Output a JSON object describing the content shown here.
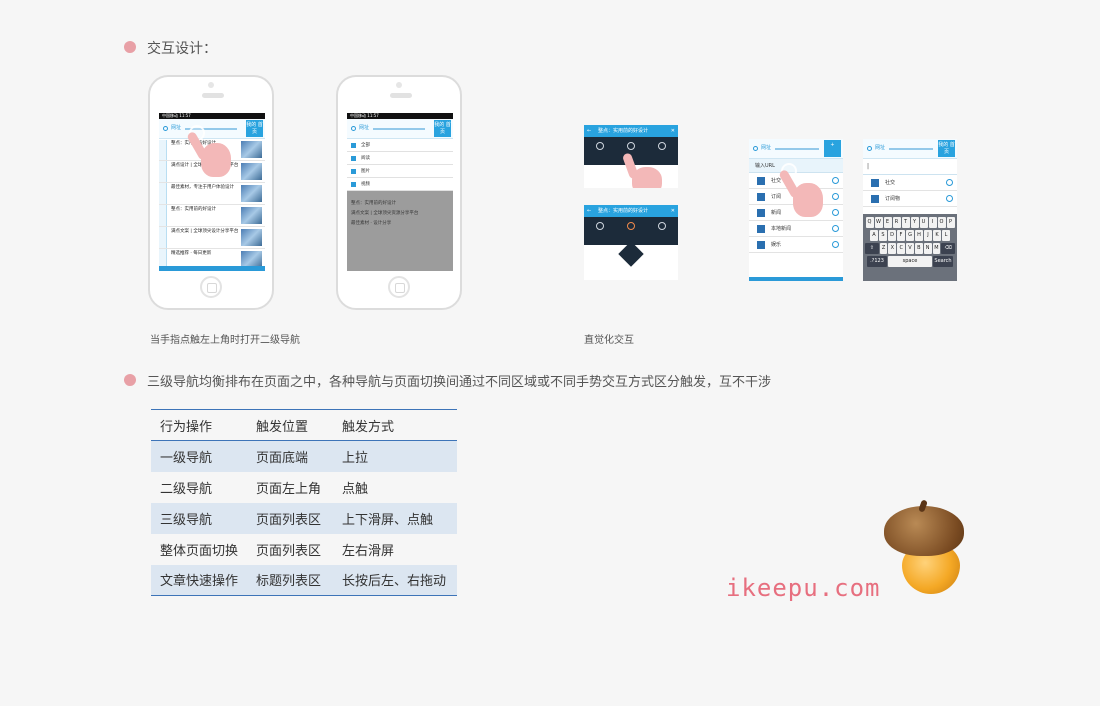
{
  "section1": {
    "title": "交互设计："
  },
  "phone1": {
    "status": "中国移动  11:57",
    "url_label": "网址",
    "brand": "我的\n首页",
    "feed": [
      "整点：实用前的好设计",
      "满点设计 | 全球顶尖资源分享平台",
      "最佳素材，专注于用户体验设计",
      "整点：实用前的好设计",
      "满点文案 | 全球顶尖设计分享平台",
      "精选推荐 · 每日更新"
    ]
  },
  "phone2": {
    "status": "中国移动  11:57",
    "url_label": "网址",
    "brand": "我的\n首页",
    "menu": [
      "全部",
      "阅读",
      "图片",
      "视频"
    ],
    "dim_items": [
      "整点：实用前的好设计",
      "满点文案 | 全球顶尖资源分享平台",
      "最佳素材 · 设计分享"
    ]
  },
  "shot_detail": {
    "title": "整点：实用前的好设计"
  },
  "shot_url": {
    "input": "输入URL",
    "rows": [
      "社交",
      "订阅",
      "新闻",
      "本地新闻",
      "娱乐"
    ]
  },
  "shot_kb": {
    "rows": [
      "社交",
      "订阅物"
    ],
    "kb1": [
      "Q",
      "W",
      "E",
      "R",
      "T",
      "Y",
      "U",
      "I",
      "O",
      "P"
    ],
    "kb2": [
      "A",
      "S",
      "D",
      "F",
      "G",
      "H",
      "J",
      "K",
      "L"
    ],
    "kb3": [
      "Z",
      "X",
      "C",
      "V",
      "B",
      "N",
      "M"
    ],
    "kb_num": ".?123",
    "kb_space": "space",
    "kb_search": "Search"
  },
  "captions": {
    "left": "当手指点触左上角时打开二级导航",
    "right": "直觉化交互"
  },
  "section2": {
    "title": "三级导航均衡排布在页面之中，各种导航与页面切换间通过不同区域或不同手势交互方式区分触发，互不干涉"
  },
  "table": {
    "headers": [
      "行为操作",
      "触发位置",
      "触发方式"
    ],
    "rows": [
      [
        "一级导航",
        "页面底端",
        "上拉"
      ],
      [
        "二级导航",
        "页面左上角",
        "点触"
      ],
      [
        "三级导航",
        "页面列表区",
        "上下滑屏、点触"
      ],
      [
        "整体页面切换",
        "页面列表区",
        "左右滑屏"
      ],
      [
        "文章快速操作",
        "标题列表区",
        "长按后左、右拖动"
      ]
    ]
  },
  "watermark": "ikeepu.com"
}
